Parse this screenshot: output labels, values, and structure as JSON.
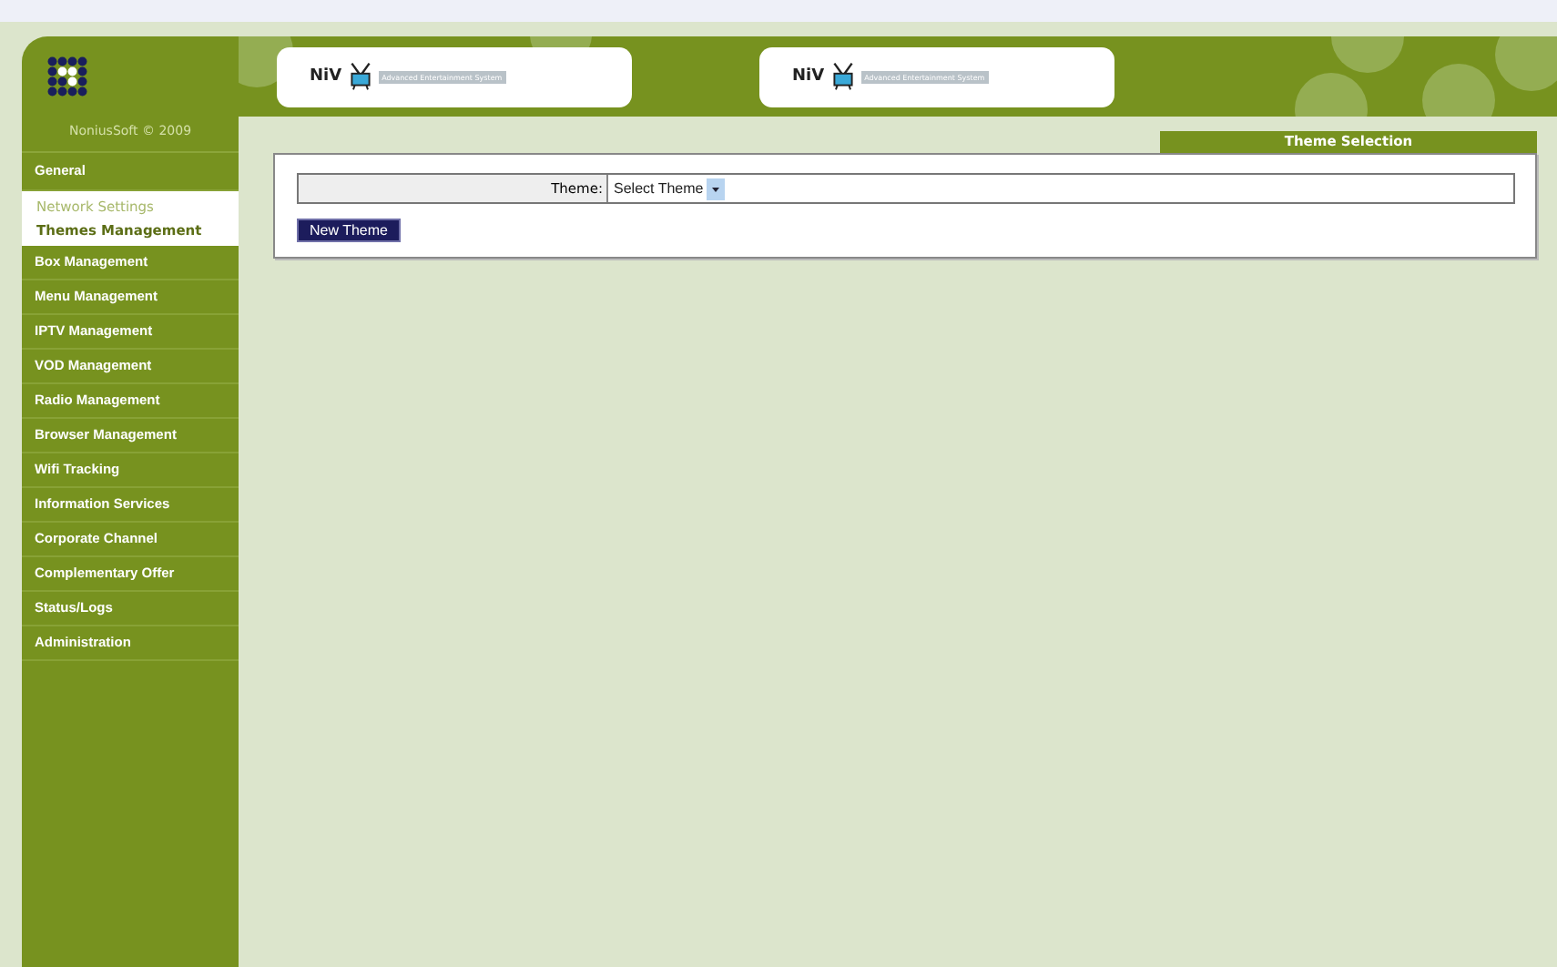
{
  "brand": {
    "copyright": "NoniusSoft © 2009"
  },
  "banners": [
    {
      "name": "NiV",
      "tagline": "Advanced Entertainment System"
    },
    {
      "name": "NiV",
      "tagline": "Advanced Entertainment System"
    }
  ],
  "sidebar": {
    "items": [
      {
        "label": "General",
        "expanded": true,
        "children": [
          {
            "label": "Network Settings",
            "selected": false
          },
          {
            "label": "Themes Management",
            "selected": true
          }
        ]
      },
      {
        "label": "Box Management",
        "expanded": false
      },
      {
        "label": "Menu Management",
        "expanded": false
      },
      {
        "label": "IPTV Management",
        "expanded": false
      },
      {
        "label": "VOD Management",
        "expanded": false
      },
      {
        "label": "Radio Management",
        "expanded": false
      },
      {
        "label": "Browser Management",
        "expanded": false
      },
      {
        "label": "Wifi Tracking",
        "expanded": false
      },
      {
        "label": "Information Services",
        "expanded": false
      },
      {
        "label": "Corporate Channel",
        "expanded": false
      },
      {
        "label": "Complementary Offer",
        "expanded": false
      },
      {
        "label": "Status/Logs",
        "expanded": false
      },
      {
        "label": "Administration",
        "expanded": false
      }
    ]
  },
  "panel": {
    "title": "Theme Selection",
    "field": {
      "label": "Theme:",
      "value": "Select Theme"
    },
    "button": "New Theme"
  }
}
